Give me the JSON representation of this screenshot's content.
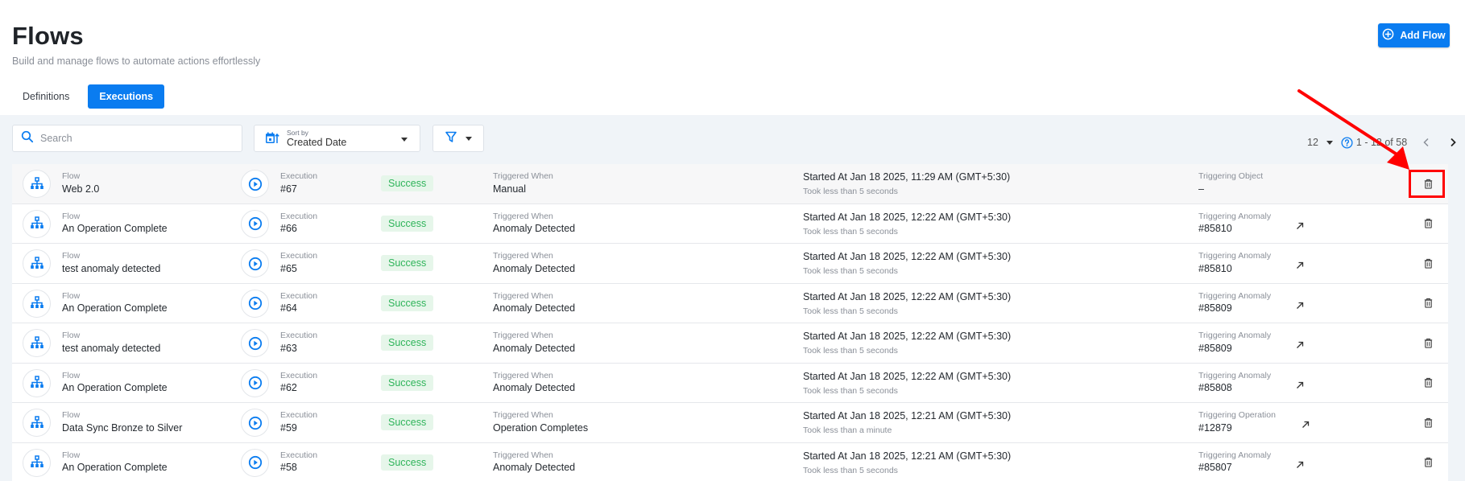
{
  "header": {
    "title": "Flows",
    "subtitle": "Build and manage flows to automate actions effortlessly",
    "add_button_label": "Add Flow"
  },
  "tabs": [
    {
      "label": "Definitions",
      "active": false
    },
    {
      "label": "Executions",
      "active": true
    }
  ],
  "toolbar": {
    "search_placeholder": "Search",
    "search_value": "",
    "sort_label": "Sort by",
    "sort_value": "Created Date",
    "page_size": "12",
    "page_range": "1 - 12 of 58"
  },
  "rows": [
    {
      "flow_label": "Flow",
      "flow_name": "Web 2.0",
      "exec_label": "Execution",
      "exec_id": "#67",
      "status": "Success",
      "trig_label": "Triggered When",
      "trig_value": "Manual",
      "started": "Started At Jan 18 2025, 11:29 AM (GMT+5:30)",
      "duration": "Took less than 5 seconds",
      "obj_label": "Triggering Object",
      "obj_value": "–",
      "has_link": false
    },
    {
      "flow_label": "Flow",
      "flow_name": "An Operation Complete",
      "exec_label": "Execution",
      "exec_id": "#66",
      "status": "Success",
      "trig_label": "Triggered When",
      "trig_value": "Anomaly Detected",
      "started": "Started At Jan 18 2025, 12:22 AM (GMT+5:30)",
      "duration": "Took less than 5 seconds",
      "obj_label": "Triggering Anomaly",
      "obj_value": "#85810",
      "has_link": true
    },
    {
      "flow_label": "Flow",
      "flow_name": "test anomaly detected",
      "exec_label": "Execution",
      "exec_id": "#65",
      "status": "Success",
      "trig_label": "Triggered When",
      "trig_value": "Anomaly Detected",
      "started": "Started At Jan 18 2025, 12:22 AM (GMT+5:30)",
      "duration": "Took less than 5 seconds",
      "obj_label": "Triggering Anomaly",
      "obj_value": "#85810",
      "has_link": true
    },
    {
      "flow_label": "Flow",
      "flow_name": "An Operation Complete",
      "exec_label": "Execution",
      "exec_id": "#64",
      "status": "Success",
      "trig_label": "Triggered When",
      "trig_value": "Anomaly Detected",
      "started": "Started At Jan 18 2025, 12:22 AM (GMT+5:30)",
      "duration": "Took less than 5 seconds",
      "obj_label": "Triggering Anomaly",
      "obj_value": "#85809",
      "has_link": true
    },
    {
      "flow_label": "Flow",
      "flow_name": "test anomaly detected",
      "exec_label": "Execution",
      "exec_id": "#63",
      "status": "Success",
      "trig_label": "Triggered When",
      "trig_value": "Anomaly Detected",
      "started": "Started At Jan 18 2025, 12:22 AM (GMT+5:30)",
      "duration": "Took less than 5 seconds",
      "obj_label": "Triggering Anomaly",
      "obj_value": "#85809",
      "has_link": true
    },
    {
      "flow_label": "Flow",
      "flow_name": "An Operation Complete",
      "exec_label": "Execution",
      "exec_id": "#62",
      "status": "Success",
      "trig_label": "Triggered When",
      "trig_value": "Anomaly Detected",
      "started": "Started At Jan 18 2025, 12:22 AM (GMT+5:30)",
      "duration": "Took less than 5 seconds",
      "obj_label": "Triggering Anomaly",
      "obj_value": "#85808",
      "has_link": true
    },
    {
      "flow_label": "Flow",
      "flow_name": "Data Sync Bronze to Silver",
      "exec_label": "Execution",
      "exec_id": "#59",
      "status": "Success",
      "trig_label": "Triggered When",
      "trig_value": "Operation Completes",
      "started": "Started At Jan 18 2025, 12:21 AM (GMT+5:30)",
      "duration": "Took less than a minute",
      "obj_label": "Triggering Operation",
      "obj_value": "#12879",
      "has_link": true
    },
    {
      "flow_label": "Flow",
      "flow_name": "An Operation Complete",
      "exec_label": "Execution",
      "exec_id": "#58",
      "status": "Success",
      "trig_label": "Triggered When",
      "trig_value": "Anomaly Detected",
      "started": "Started At Jan 18 2025, 12:21 AM (GMT+5:30)",
      "duration": "Took less than 5 seconds",
      "obj_label": "Triggering Anomaly",
      "obj_value": "#85807",
      "has_link": true
    }
  ],
  "icons": {
    "add": "plus-circle-icon",
    "search": "search-icon",
    "sort": "calendar-sort-icon",
    "filter": "filter-icon",
    "help": "help-circle-icon",
    "prev": "chevron-left-icon",
    "next": "chevron-right-icon",
    "flow": "sitemap-icon",
    "execution": "play-circle-icon",
    "link": "arrow-up-right-icon",
    "delete": "trash-icon"
  },
  "colors": {
    "primary": "#0a7cf0",
    "success_text": "#2fb45a",
    "success_bg": "#e6f6ea",
    "annotation": "#ff0000"
  }
}
